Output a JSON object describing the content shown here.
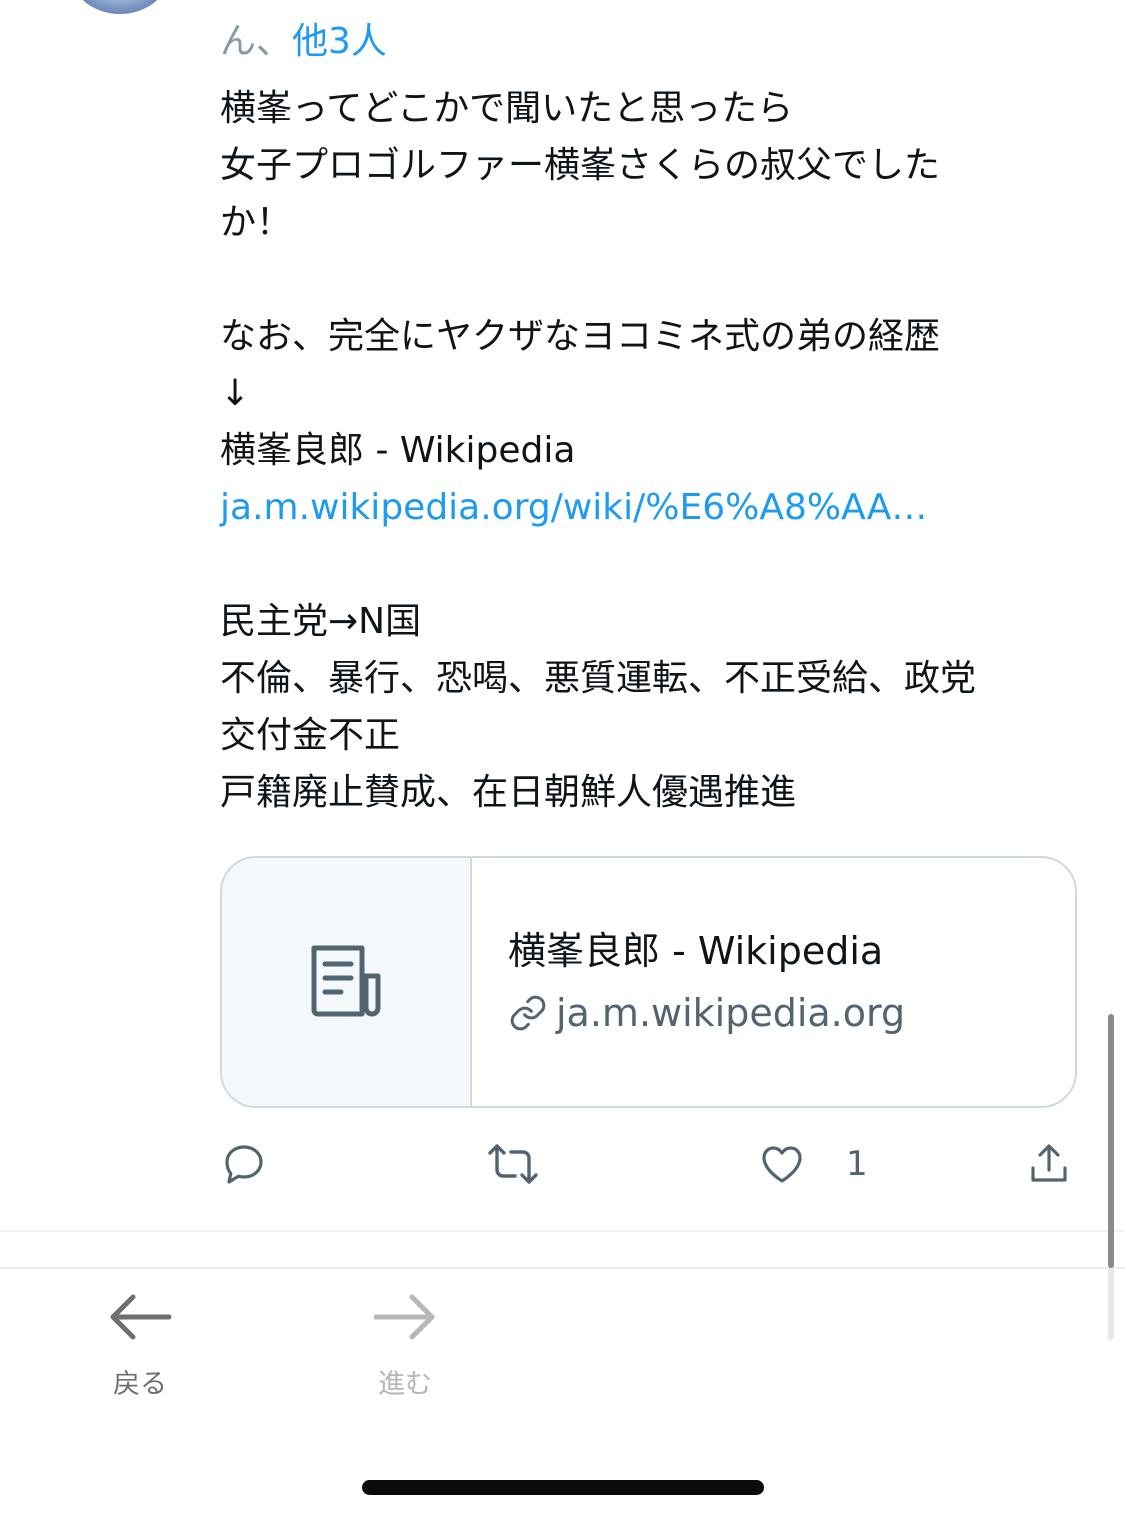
{
  "reply_context": {
    "prefix": "ん、",
    "others": "他3人"
  },
  "tweet": {
    "lines": [
      "横峯ってどこかで聞いたと思ったら",
      "女子プロゴルファー横峯さくらの叔父でした",
      "か！",
      "",
      "なお、完全にヤクザなヨコミネ式の弟の経歴",
      "↓",
      "横峯良郎 - Wikipedia",
      "ja.m.wikipedia.org/wiki/%E6%A8%AA…",
      "",
      "民主党→N国",
      "不倫、暴行、恐喝、悪質運転、不正受給、政党",
      "交付金不正",
      "戸籍廃止賛成、在日朝鮮人優遇推進"
    ]
  },
  "card": {
    "title": "横峯良郎 - Wikipedia",
    "domain": "ja.m.wikipedia.org"
  },
  "actions": {
    "like_count": "1"
  },
  "nav": {
    "back_label": "戻る",
    "forward_label": "進む"
  },
  "colors": {
    "link": "#1d9bf0",
    "icon": "#536471",
    "separator": "#eff3f4"
  }
}
